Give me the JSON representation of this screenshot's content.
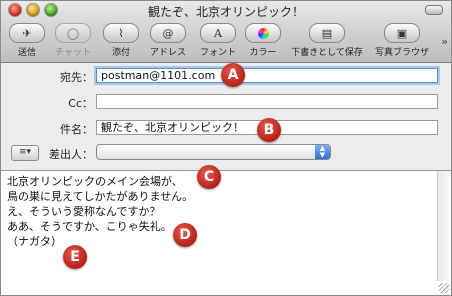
{
  "window": {
    "title": "観たぞ、北京オリンピック！"
  },
  "toolbar": {
    "items": [
      {
        "label": "送信",
        "icon": "send-icon"
      },
      {
        "label": "チャット",
        "icon": "chat-icon",
        "disabled": true
      },
      {
        "label": "添付",
        "icon": "paperclip-icon"
      },
      {
        "label": "アドレス",
        "icon": "address-book-icon"
      },
      {
        "label": "フォント",
        "icon": "font-icon"
      },
      {
        "label": "カラー",
        "icon": "color-wheel-icon"
      },
      {
        "label": "下書きとして保存",
        "icon": "save-draft-icon"
      },
      {
        "label": "写真ブラウザ",
        "icon": "photo-browser-icon"
      }
    ],
    "overflow": "»"
  },
  "headers": {
    "to_label": "宛先：",
    "to_value": "postman@1101.com",
    "cc_label": "Cc：",
    "cc_value": "",
    "subject_label": "件名：",
    "subject_value": "観たぞ、北京オリンピック！",
    "from_label": "差出人：",
    "from_value": "",
    "account_button": "≡▾"
  },
  "body": {
    "lines": [
      "北京オリンピックのメイン会場が、",
      "鳥の巣に見えてしかたがありません。",
      "え、そういう愛称なんですか？",
      "ああ、そうですか、こりゃ失礼。",
      "（ナガタ）"
    ]
  },
  "markers": [
    "A",
    "B",
    "C",
    "D",
    "E"
  ],
  "colors": {
    "marker": "#c0261c",
    "focus": "#5b8fd6",
    "select_arrow": "#2f6fd0"
  }
}
